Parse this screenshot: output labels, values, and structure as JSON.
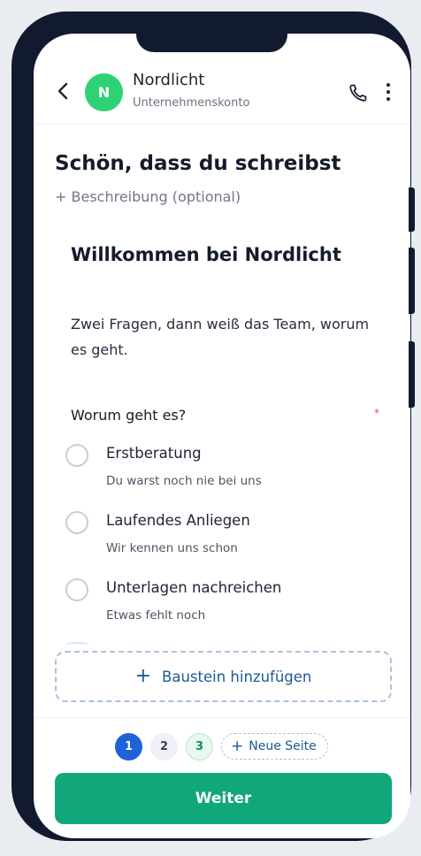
{
  "header": {
    "avatar_letter": "N",
    "name": "Nordlicht",
    "subtitle": "Unternehmenskonto",
    "icons": {
      "back": "chevron-left-icon",
      "call": "phone-icon",
      "menu": "more-vertical-icon"
    }
  },
  "form": {
    "title": "Schön, dass du schreibst",
    "description_placeholder": "+ Beschreibung (optional)",
    "welcome_heading": "Willkommen bei Nordlicht",
    "intro_text": "Zwei Fragen, dann weiß das Team, worum es geht.",
    "question": "Worum geht es?",
    "required_mark": "*",
    "options": [
      {
        "label": "Erstberatung",
        "hint": "Du warst noch nie bei uns"
      },
      {
        "label": "Laufendes Anliegen",
        "hint": "Wir kennen uns schon"
      },
      {
        "label": "Unterlagen nachreichen",
        "hint": "Etwas fehlt noch"
      }
    ],
    "add_block_label": "Baustein hinzufügen"
  },
  "footer": {
    "pages": [
      "1",
      "2",
      "3"
    ],
    "active_page": "1",
    "new_page_label": "Neue Seite",
    "cta_label": "Weiter"
  },
  "colors": {
    "accent": "#10a77b",
    "avatar": "#2fd177",
    "page_active": "#1f62d6",
    "link": "#1c5a95",
    "frame": "#111a2e"
  }
}
